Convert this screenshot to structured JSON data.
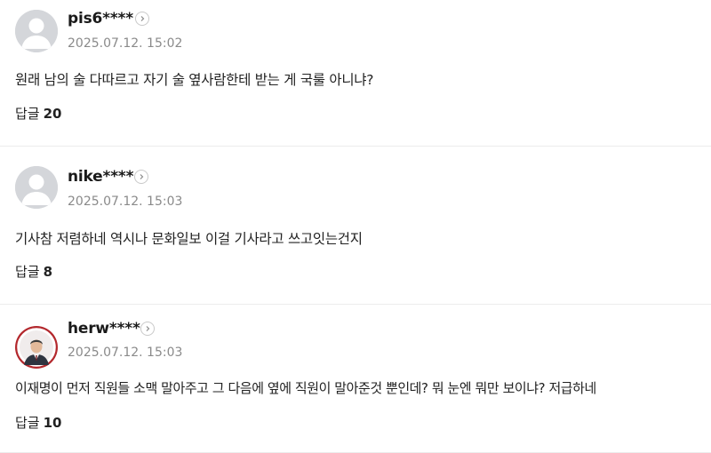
{
  "comments": [
    {
      "username": "pis6****",
      "timestamp": "2025.07.12. 15:02",
      "text": "원래 남의 술 다따르고 자기 술 옆사람한테 받는 게 국룰 아니냐?",
      "reply_label": "답글",
      "reply_count": "20",
      "avatar": "default-avatar"
    },
    {
      "username": "nike****",
      "timestamp": "2025.07.12. 15:03",
      "text": "기사참 저렴하네 역시나 문화일보 이걸 기사라고 쓰고잇는건지",
      "reply_label": "답글",
      "reply_count": "8",
      "avatar": "default-avatar"
    },
    {
      "username": "herw****",
      "timestamp": "2025.07.12. 15:03",
      "text": "이재명이 먼저 직원들 소맥 말아주고 그 다음에 옆에 직원이 말아준것 뿐인데? 뭐 눈엔 뭐만 보이냐? 저급하네",
      "reply_label": "답글",
      "reply_count": "10",
      "avatar": "profile-photo"
    }
  ],
  "colors": {
    "username": "#1a1a1a",
    "timestamp": "#8a8a8a",
    "divider": "#ececec",
    "avatar_bg": "#d4d6da",
    "photo_ring": "#b3282d"
  },
  "icons": {
    "more": "chevron-right-icon",
    "avatar_default": "person-icon"
  }
}
